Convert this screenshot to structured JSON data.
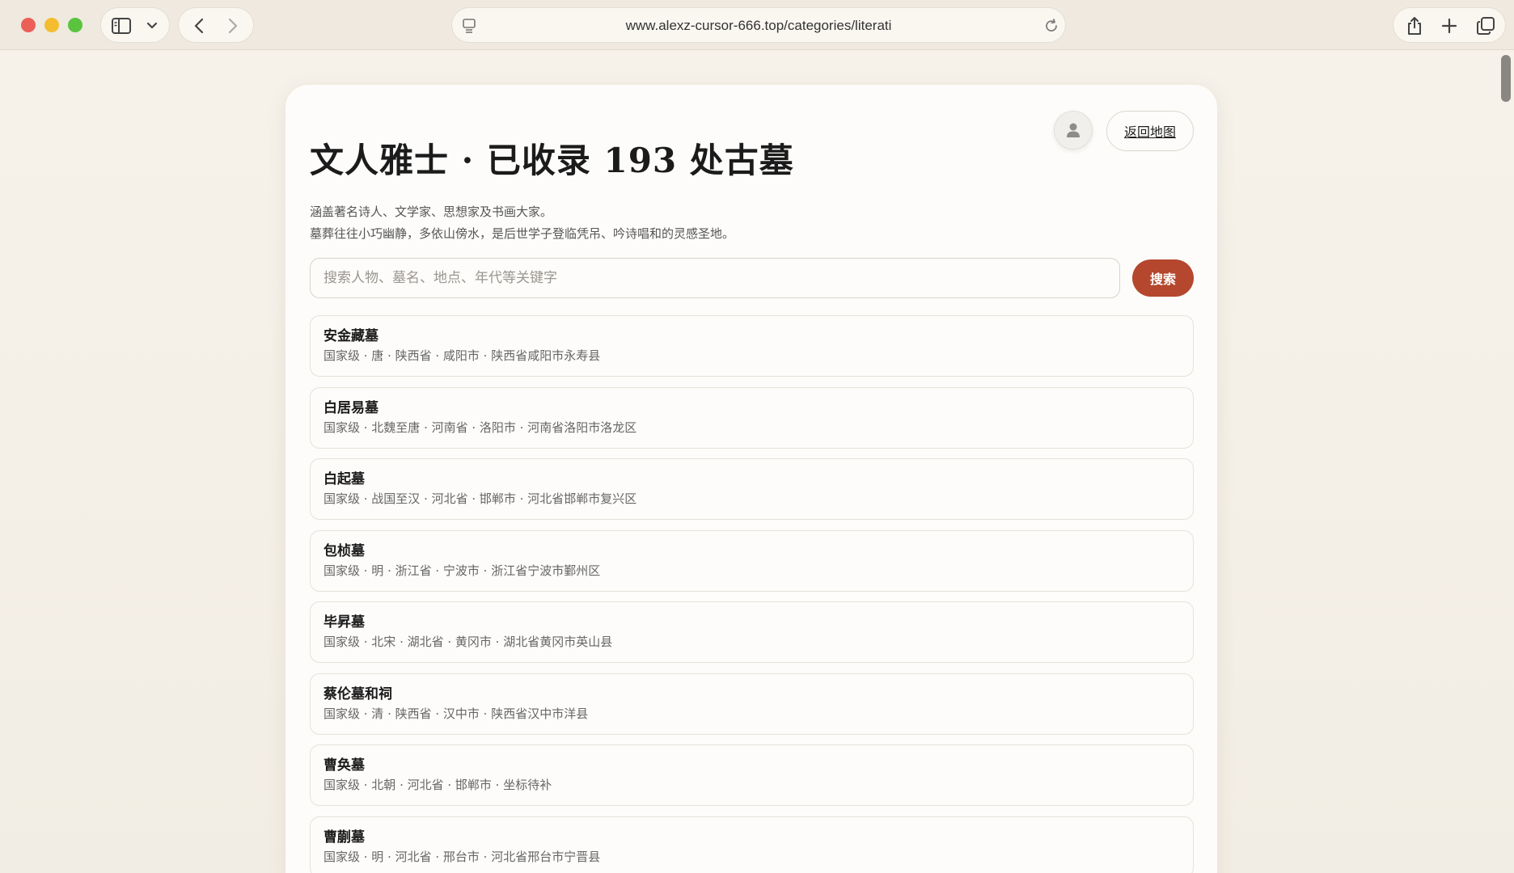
{
  "browser": {
    "url": "www.alexz-cursor-666.top/categories/literati"
  },
  "header": {
    "title": "文人雅士 · 已收录 193 处古墓",
    "back_label": "返回地图",
    "description_lines": [
      "涵盖著名诗人、文学家、思想家及书画大家。",
      "墓葬往往小巧幽静，多依山傍水，是后世学子登临凭吊、吟诗唱和的灵感圣地。"
    ]
  },
  "search": {
    "placeholder": "搜索人物、墓名、地点、年代等关键字",
    "value": "",
    "button_label": "搜索"
  },
  "tombs": [
    {
      "name": "安金藏墓",
      "meta": "国家级 · 唐 · 陕西省 · 咸阳市 · 陕西省咸阳市永寿县"
    },
    {
      "name": "白居易墓",
      "meta": "国家级 · 北魏至唐 · 河南省 · 洛阳市 · 河南省洛阳市洛龙区"
    },
    {
      "name": "白起墓",
      "meta": "国家级 · 战国至汉 · 河北省 · 邯郸市 · 河北省邯郸市复兴区"
    },
    {
      "name": "包桢墓",
      "meta": "国家级 · 明 · 浙江省 · 宁波市 · 浙江省宁波市鄞州区"
    },
    {
      "name": "毕昇墓",
      "meta": "国家级 · 北宋 · 湖北省 · 黄冈市 · 湖北省黄冈市英山县"
    },
    {
      "name": "蔡伦墓和祠",
      "meta": "国家级 · 清 · 陕西省 · 汉中市 · 陕西省汉中市洋县"
    },
    {
      "name": "曹奂墓",
      "meta": "国家级 · 北朝 · 河北省 · 邯郸市 · 坐标待补"
    },
    {
      "name": "曹蒯墓",
      "meta": "国家级 · 明 · 河北省 · 邢台市 · 河北省邢台市宁晋县"
    }
  ],
  "colors": {
    "accent": "#b4472e",
    "background": "#f3eee6",
    "card": "#fdfcfa"
  }
}
